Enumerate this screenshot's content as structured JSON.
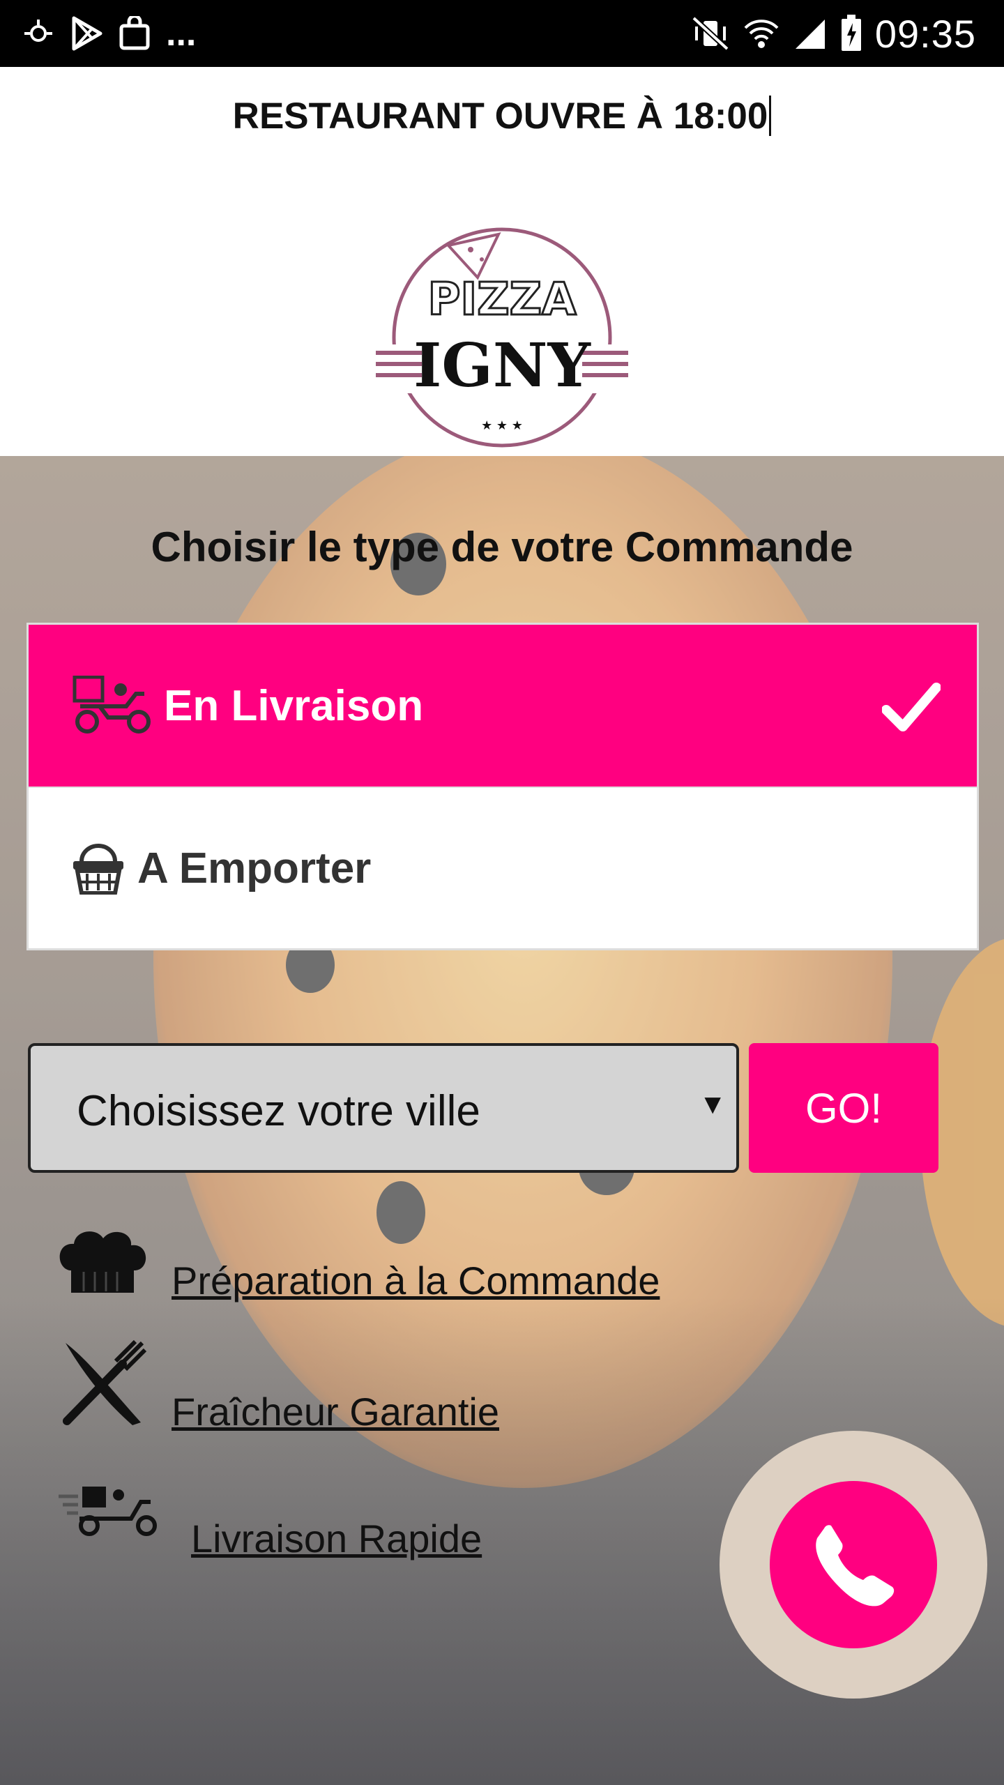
{
  "status_bar": {
    "time": "09:35",
    "overflow": "...",
    "left_icons": [
      "sync-icon",
      "play-store-icon",
      "shopping-bag-icon"
    ],
    "right_icons": [
      "vibrate-mute-icon",
      "wifi-icon",
      "signal-icon",
      "battery-charging-icon"
    ]
  },
  "notice": {
    "text": "RESTAURANT OUVRE À 18:00"
  },
  "logo": {
    "line1": "PIZZA",
    "line2": "IGNY",
    "stars": "★ ★ ★"
  },
  "order": {
    "title": "Choisir le type de votre Commande",
    "options": [
      {
        "label": "En Livraison",
        "icon": "delivery-scooter-icon",
        "selected": true
      },
      {
        "label": "A Emporter",
        "icon": "basket-icon",
        "selected": false
      }
    ]
  },
  "city": {
    "placeholder": "Choisissez votre ville",
    "arrow": "▼",
    "go_label": "GO!"
  },
  "features": [
    {
      "label": "Préparation à la Commande",
      "icon": "chef-hat-icon"
    },
    {
      "label": "Fraîcheur Garantie",
      "icon": "knife-fork-icon"
    },
    {
      "label": "Livraison Rapide",
      "icon": "fast-delivery-icon"
    }
  ],
  "colors": {
    "accent": "#ff0080",
    "logo_ring": "#9c5a7a",
    "select_bg": "#d4d4d4",
    "phone_halo": "#ddd0c2"
  }
}
